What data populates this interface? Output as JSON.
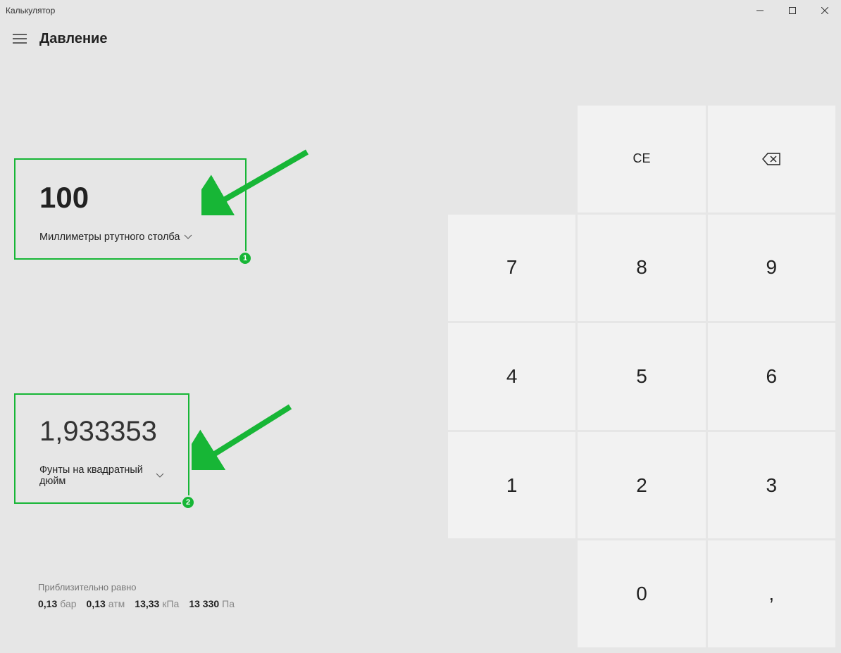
{
  "window": {
    "title": "Калькулятор"
  },
  "header": {
    "title": "Давление"
  },
  "conversion": {
    "input": {
      "value": "100",
      "unit": "Миллиметры ртутного столба",
      "badge": "1"
    },
    "output": {
      "value": "1,933353",
      "unit": "Фунты на квадратный дюйм",
      "badge": "2"
    }
  },
  "approx": {
    "label": "Приблизительно равно",
    "items": [
      {
        "value": "0,13",
        "unit": "бар"
      },
      {
        "value": "0,13",
        "unit": "атм"
      },
      {
        "value": "13,33",
        "unit": "кПа"
      },
      {
        "value": "13 330",
        "unit": "Па"
      }
    ]
  },
  "keypad": {
    "ce": "CE",
    "k7": "7",
    "k8": "8",
    "k9": "9",
    "k4": "4",
    "k5": "5",
    "k6": "6",
    "k1": "1",
    "k2": "2",
    "k3": "3",
    "k0": "0",
    "dec": ","
  }
}
